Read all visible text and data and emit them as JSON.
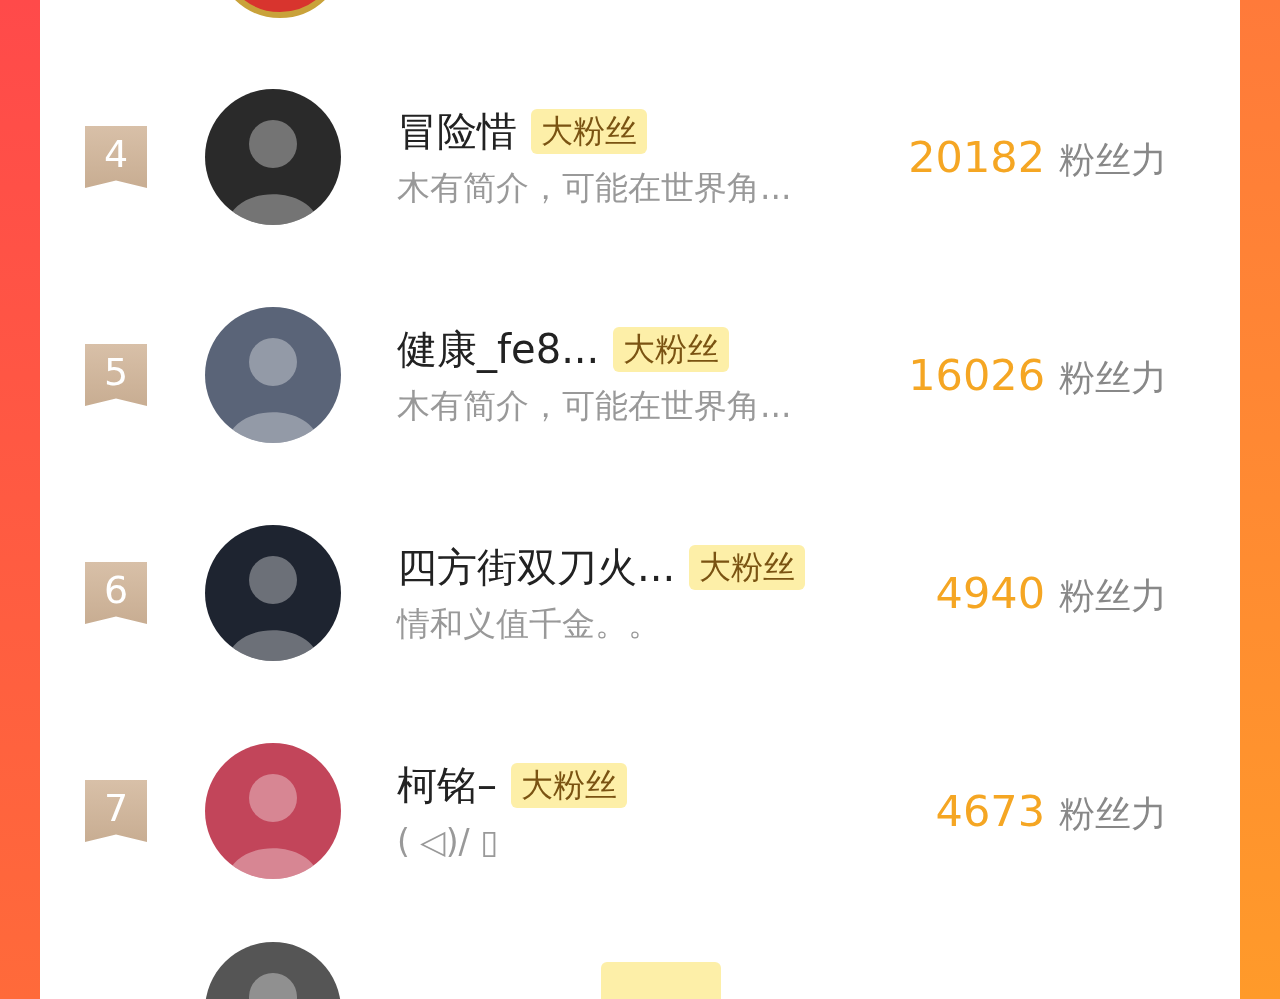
{
  "rows": [
    {
      "rank": "4",
      "name": "冒险惜",
      "badge": "大粉丝",
      "description": "木有简介，可能在世界角...",
      "score": "20182",
      "score_label": "粉丝力"
    },
    {
      "rank": "5",
      "name": "健康_fe8...",
      "badge": "大粉丝",
      "description": "木有简介，可能在世界角...",
      "score": "16026",
      "score_label": "粉丝力"
    },
    {
      "rank": "6",
      "name": "四方街双刀火...",
      "badge": "大粉丝",
      "description": "情和义值千金。。",
      "score": "4940",
      "score_label": "粉丝力"
    },
    {
      "rank": "7",
      "name": "柯铭–",
      "badge": "大粉丝",
      "description": "( ◁)/ ▯",
      "score": "4673",
      "score_label": "粉丝力"
    }
  ]
}
